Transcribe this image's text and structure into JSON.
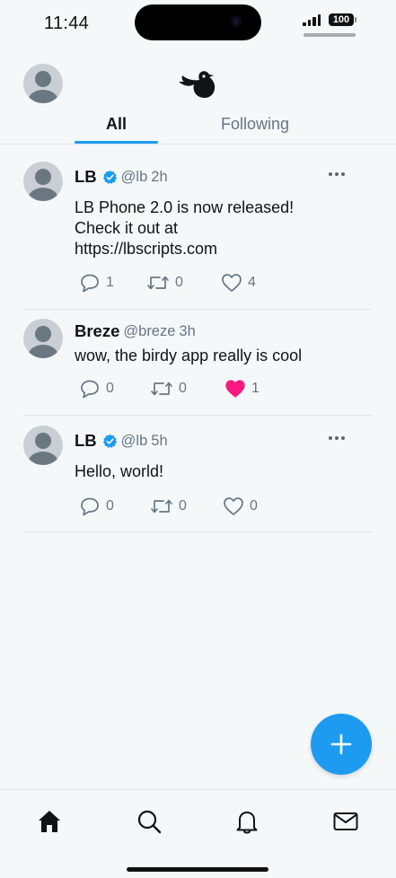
{
  "status_bar": {
    "time": "11:44",
    "battery": "100"
  },
  "header": {
    "tabs": [
      {
        "label": "All",
        "active": true
      },
      {
        "label": "Following",
        "active": false
      }
    ]
  },
  "posts": [
    {
      "name": "LB",
      "verified": true,
      "handle": "@lb",
      "time": "2h",
      "lines": [
        "LB Phone 2.0 is now released!",
        "Check it out at",
        "https://lbscripts.com"
      ],
      "replies": "1",
      "retweets": "0",
      "likes": "4",
      "liked": false
    },
    {
      "name": "Breze",
      "verified": false,
      "handle": "@breze",
      "time": "3h",
      "lines": [
        "wow, the birdy app really is cool"
      ],
      "replies": "0",
      "retweets": "0",
      "likes": "1",
      "liked": true
    },
    {
      "name": "LB",
      "verified": true,
      "handle": "@lb",
      "time": "5h",
      "lines": [
        "Hello, world!"
      ],
      "replies": "0",
      "retweets": "0",
      "likes": "0",
      "liked": false
    }
  ],
  "bottom_nav": [
    "home-icon",
    "search-icon",
    "bell-icon",
    "mail-icon"
  ],
  "colors": {
    "accent": "#1d9bf0",
    "like": "#f91880",
    "text": "#0f1419",
    "muted": "#657786"
  }
}
